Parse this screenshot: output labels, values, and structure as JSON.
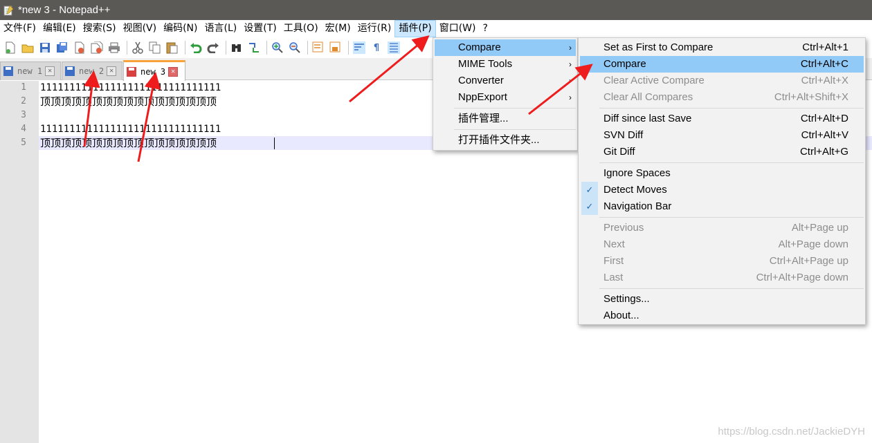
{
  "window": {
    "title": "*new 3 - Notepad++"
  },
  "menubar": [
    "文件(F)",
    "编辑(E)",
    "搜索(S)",
    "视图(V)",
    "编码(N)",
    "语言(L)",
    "设置(T)",
    "工具(O)",
    "宏(M)",
    "运行(R)",
    "插件(P)",
    "窗口(W)",
    "?"
  ],
  "tabs": [
    {
      "label": "new 1"
    },
    {
      "label": "new 2"
    },
    {
      "label": "new 3"
    }
  ],
  "editor": {
    "line_numbers": [
      "1",
      "2",
      "3",
      "4",
      "5"
    ],
    "lines": [
      "1111111111111111111111111111111",
      "顶顶顶顶顶顶顶顶顶顶顶顶顶顶顶顶顶",
      "",
      "1111111111111111111111111111111",
      "顶顶顶顶顶顶顶顶顶顶顶顶顶顶顶顶顶"
    ]
  },
  "plugins_menu": {
    "items": [
      {
        "label": "Compare",
        "submenu_arrow": "›"
      },
      {
        "label": "MIME Tools",
        "submenu_arrow": "›"
      },
      {
        "label": "Converter",
        "submenu_arrow": "›"
      },
      {
        "label": "NppExport",
        "submenu_arrow": "›"
      },
      {
        "label": "插件管理..."
      },
      {
        "label": "打开插件文件夹..."
      }
    ]
  },
  "compare_menu": {
    "items": [
      {
        "label": "Set as First to Compare",
        "shortcut": "Ctrl+Alt+1"
      },
      {
        "label": "Compare",
        "shortcut": "Ctrl+Alt+C"
      },
      {
        "label": "Clear Active Compare",
        "shortcut": "Ctrl+Alt+X"
      },
      {
        "label": "Clear All Compares",
        "shortcut": "Ctrl+Alt+Shift+X"
      },
      {
        "label": "Diff since last Save",
        "shortcut": "Ctrl+Alt+D"
      },
      {
        "label": "SVN Diff",
        "shortcut": "Ctrl+Alt+V"
      },
      {
        "label": "Git Diff",
        "shortcut": "Ctrl+Alt+G"
      },
      {
        "label": "Ignore Spaces"
      },
      {
        "label": "Detect Moves",
        "checked": "✓"
      },
      {
        "label": "Navigation Bar",
        "checked": "✓"
      },
      {
        "label": "Previous",
        "shortcut": "Alt+Page up"
      },
      {
        "label": "Next",
        "shortcut": "Alt+Page down"
      },
      {
        "label": "First",
        "shortcut": "Ctrl+Alt+Page up"
      },
      {
        "label": "Last",
        "shortcut": "Ctrl+Alt+Page down"
      },
      {
        "label": "Settings..."
      },
      {
        "label": "About..."
      }
    ]
  },
  "watermark": "https://blog.csdn.net/JackieDYH",
  "colors": {
    "highlight": "#91c9f7",
    "arrow": "#ee1c1c",
    "active_tab_accent": "#f9a23a"
  }
}
